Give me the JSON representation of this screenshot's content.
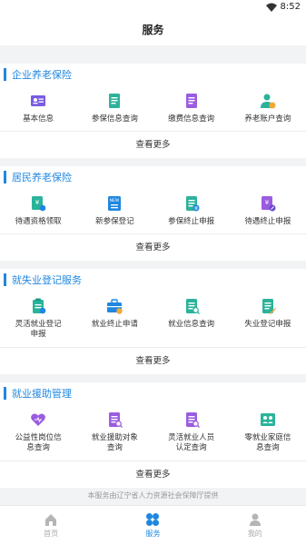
{
  "status": {
    "time": "8:52"
  },
  "header": {
    "title": "服务"
  },
  "sections": [
    {
      "title": "企业养老保险",
      "items": [
        {
          "label": "基本信息",
          "icon": "id-card-icon",
          "color": "#7a5ce0"
        },
        {
          "label": "参保信息查询",
          "icon": "document-icon",
          "color": "#2bb39a"
        },
        {
          "label": "缴费信息查询",
          "icon": "document-icon",
          "color": "#9b5ce0"
        },
        {
          "label": "养老账户查询",
          "icon": "person-yuan-icon",
          "color": "#2bb39a"
        }
      ],
      "more": "查看更多"
    },
    {
      "title": "居民养老保险",
      "items": [
        {
          "label": "待遇资格领取",
          "icon": "yuan-document-icon",
          "color": "#2bb39a"
        },
        {
          "label": "新参保登记",
          "icon": "new-badge-icon",
          "color": "#1f87e0"
        },
        {
          "label": "参保终止申报",
          "icon": "document-pause-icon",
          "color": "#2bb39a"
        },
        {
          "label": "待遇终止申报",
          "icon": "yuan-document-cancel-icon",
          "color": "#9b5ce0"
        }
      ],
      "more": "查看更多"
    },
    {
      "title": "就失业登记服务",
      "items": [
        {
          "label": "灵活就业登记\n申报",
          "icon": "clipboard-icon",
          "color": "#2bb39a"
        },
        {
          "label": "就业终止申请",
          "icon": "briefcase-icon",
          "color": "#1f87e0"
        },
        {
          "label": "就业信息查询",
          "icon": "document-search-icon",
          "color": "#2bb39a"
        },
        {
          "label": "失业登记申报",
          "icon": "document-edit-icon",
          "color": "#2bb39a"
        }
      ],
      "more": "查看更多"
    },
    {
      "title": "就业援助管理",
      "items": [
        {
          "label": "公益性岗位信\n息查询",
          "icon": "heart-icon",
          "color": "#9b5ce0"
        },
        {
          "label": "就业援助对象\n查询",
          "icon": "document-search-icon",
          "color": "#9b5ce0"
        },
        {
          "label": "灵活就业人员\n认定查询",
          "icon": "document-search-icon",
          "color": "#9b5ce0"
        },
        {
          "label": "零就业家庭信\n息查询",
          "icon": "family-icon",
          "color": "#2bb39a"
        }
      ],
      "more": "查看更多"
    }
  ],
  "footer": {
    "note": "本服务由辽宁省人力资源社会保障厅提供"
  },
  "tabs": [
    {
      "label": "首页",
      "icon": "home-icon",
      "active": false
    },
    {
      "label": "服务",
      "icon": "grid-icon",
      "active": true
    },
    {
      "label": "我的",
      "icon": "person-icon",
      "active": false
    }
  ],
  "colors": {
    "accent": "#1f87e0",
    "background": "#f2f3f5"
  }
}
